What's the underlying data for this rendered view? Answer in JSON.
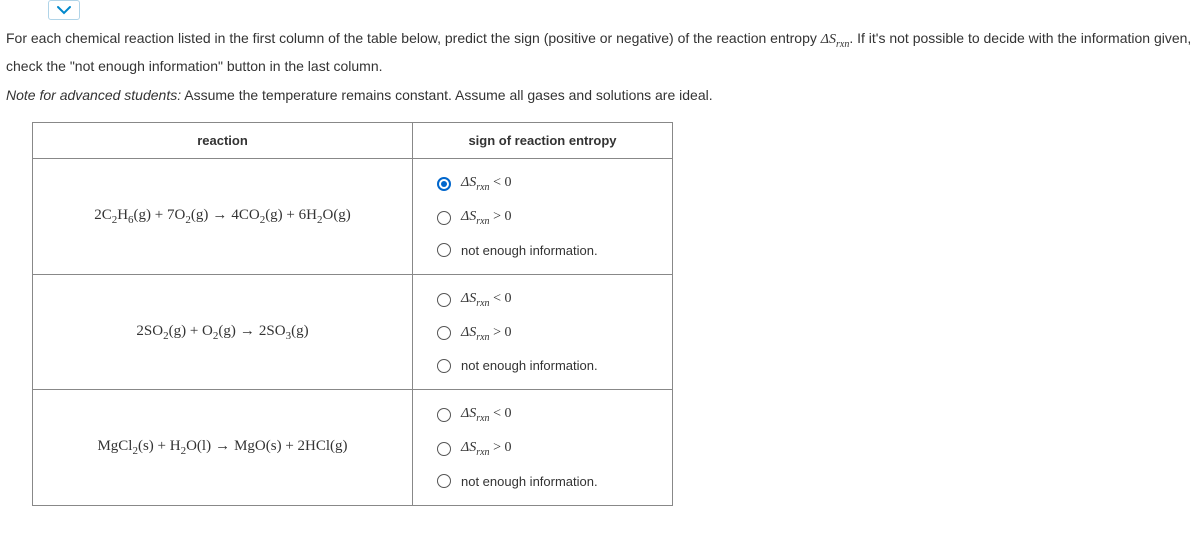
{
  "instructions": {
    "line1_part1": "For each chemical reaction listed in the first column of the table below, predict the sign (positive or negative) of the reaction entropy ",
    "line1_symbol": "ΔS",
    "line1_sub": "rxn",
    "line1_part2": ". If it's not possible to decide with the information given, check the \"not enough information\" button in the last column.",
    "note_prefix": "Note for advanced students:",
    "note_text": " Assume the temperature remains constant. Assume all gases and solutions are ideal."
  },
  "headers": {
    "reaction": "reaction",
    "sign": "sign of reaction entropy"
  },
  "options": {
    "lt_symbol": "ΔS",
    "lt_sub": "rxn",
    "lt_op": " < 0",
    "gt_symbol": "ΔS",
    "gt_sub": "rxn",
    "gt_op": " > 0",
    "nei": "not enough information."
  },
  "reactions": {
    "r1": {
      "t1": "2C",
      "s1": "2",
      "t2": "H",
      "s2": "6",
      "t3": "(g) + 7O",
      "s3": "2",
      "t4": "(g)",
      "arrow": "→",
      "t5": "4CO",
      "s5": "2",
      "t6": "(g) + 6H",
      "s6": "2",
      "t7": "O(g)",
      "selected": "lt"
    },
    "r2": {
      "t1": "2SO",
      "s1": "2",
      "t2": "(g) + O",
      "s2": "2",
      "t3": "(g)",
      "arrow": "→",
      "t4": "2SO",
      "s4": "3",
      "t5": "(g)",
      "selected": ""
    },
    "r3": {
      "t1": "MgCl",
      "s1": "2",
      "t2": "(s) + H",
      "s2": "2",
      "t3": "O(l)",
      "arrow": "→",
      "t4": "MgO(s) + 2HCl(g)",
      "selected": ""
    }
  }
}
